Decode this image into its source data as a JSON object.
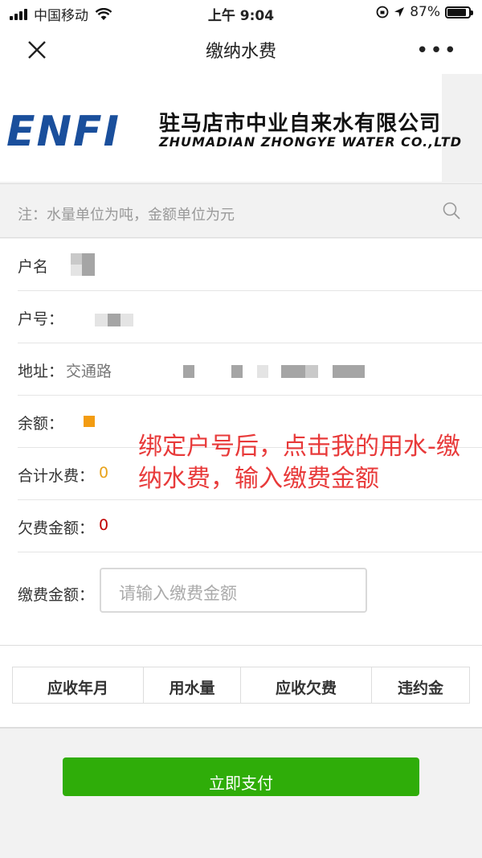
{
  "status_bar": {
    "carrier": "中国移动",
    "time": "上午 9:04",
    "battery": "87%",
    "battery_level": 0.87
  },
  "nav": {
    "title": "缴纳水费"
  },
  "banner": {
    "company_cn": "驻马店市中业自来水有限公司",
    "company_en": "ZHUMADIAN ZHONGYE WATER CO.,LTD",
    "logo_text": "ENFI"
  },
  "note": {
    "text": "注：水量单位为吨，金额单位为元"
  },
  "fields": {
    "name_label": "户名",
    "account_label": "户号：",
    "address_label": "地址：",
    "address_value": "交通路",
    "balance_label": "余额：",
    "total_fee_label": "合计水费：",
    "total_fee_value": "0",
    "arrears_label": "欠费金额：",
    "arrears_value": "0",
    "payment_label": "缴费金额：",
    "payment_placeholder": "请输入缴费金额"
  },
  "annotation": {
    "text": "绑定户号后，点击我的用水-缴纳水费，输入缴费金额"
  },
  "table": {
    "headers": [
      "应收年月",
      "用水量",
      "应收欠费",
      "违约金"
    ]
  },
  "pay_button": {
    "label": "立即支付"
  },
  "colors": {
    "accent_green": "#2fad09",
    "annotation_red": "#e83a3a",
    "total_orange": "#e8a21a",
    "arrears_red": "#c00000",
    "balance_orange": "#f39c12"
  }
}
